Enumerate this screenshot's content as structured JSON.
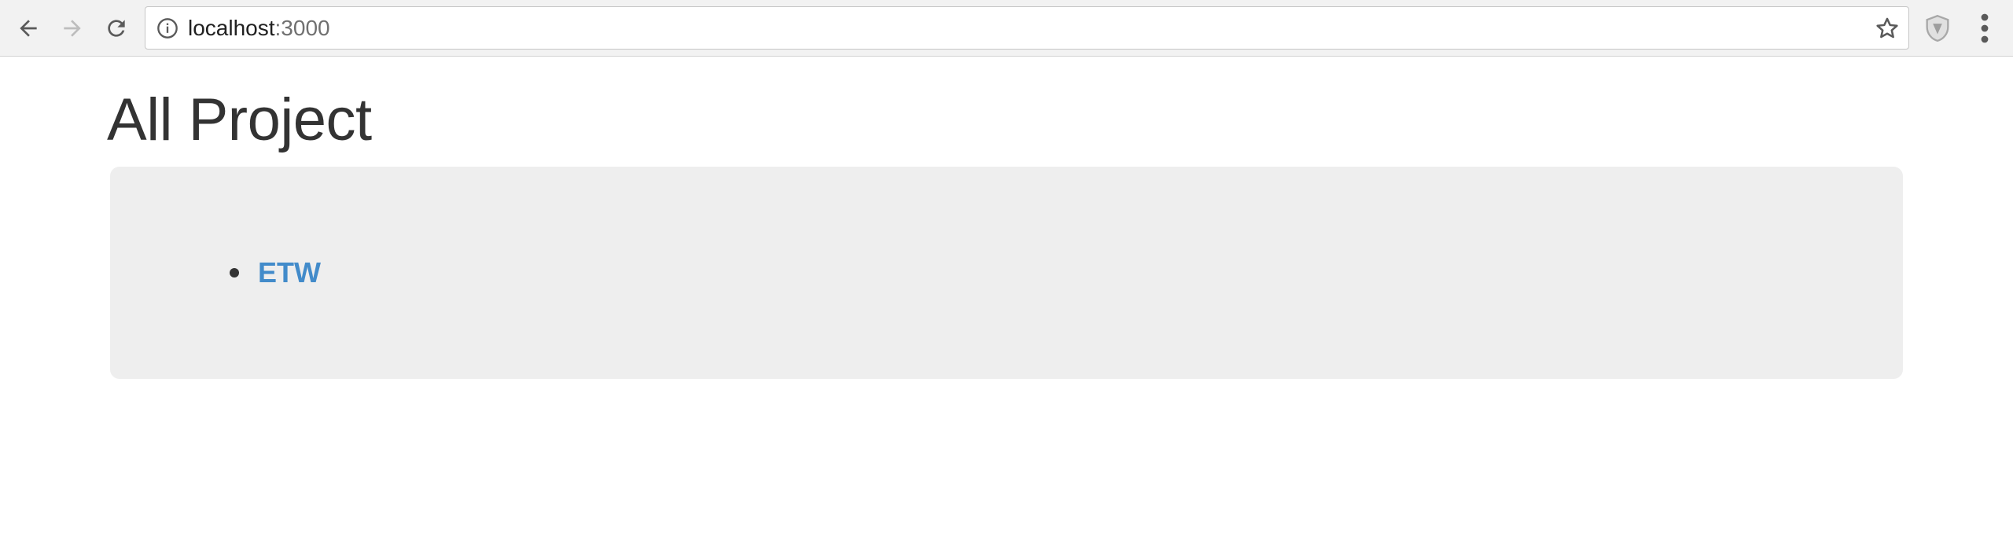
{
  "browser": {
    "url_host": "localhost",
    "url_port": ":3000",
    "icons": {
      "back": "arrow-left-icon",
      "forward": "arrow-right-icon",
      "reload": "reload-icon",
      "site_info": "info-icon",
      "bookmark": "star-icon",
      "extension": "shield-icon",
      "menu": "kebab-menu-icon"
    }
  },
  "page": {
    "title": "All Project",
    "projects": [
      {
        "name": "ETW"
      }
    ]
  },
  "colors": {
    "link": "#428bca",
    "panel_background": "#eeeeee",
    "text": "#333333"
  }
}
